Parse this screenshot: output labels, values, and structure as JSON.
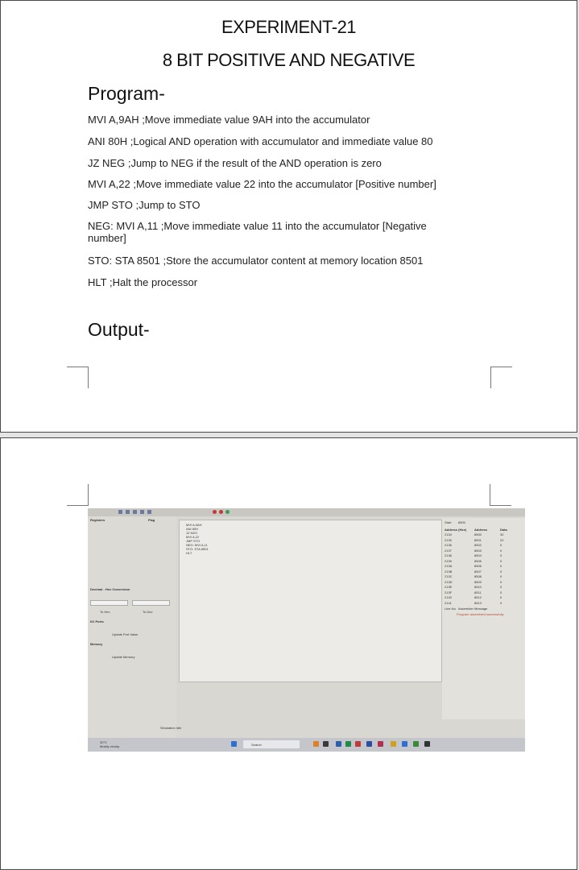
{
  "page1": {
    "title": "EXPERIMENT-21",
    "subtitle": "8 BIT POSITIVE AND NEGATIVE",
    "program_heading": "Program-",
    "program_lines": [
      "MVI A,9AH ;Move immediate value 9AH into the accumulator",
      "ANI 80H ;Logical AND operation with accumulator and immediate value 80",
      "JZ NEG ;Jump to NEG if the result of the AND operation is zero",
      "MVI A,22 ;Move immediate value 22 into the accumulator [Positive number]",
      "JMP STO ;Jump to STO",
      "NEG: MVI A,11 ;Move immediate value 11 into the accumulator [Negative number]",
      "STO: STA 8501 ;Store the accumulator content at memory location 8501",
      "HLT ;Halt the processor"
    ],
    "output_heading": "Output-"
  },
  "photo": {
    "registers_label": "Registers",
    "flag_label": "Flag",
    "dec_hex_label": "Decimal - Hex Conversion",
    "io_ports_label": "I/O Ports",
    "memory_label": "Memory",
    "update_port_label": "Update Port Value",
    "update_memory_label": "Update Memory",
    "to_hex_label": "To Hex",
    "to_dec_label": "To Dec",
    "simulation_label": "Simulation Idle",
    "search_placeholder": "Search",
    "start_label": "Start",
    "start_value": "8500",
    "table_headers": [
      "Address (Hex)",
      "Address",
      "Data"
    ],
    "table_rows": [
      [
        "2134",
        "8500",
        "32"
      ],
      [
        "2135",
        "8501",
        "22"
      ],
      [
        "2136",
        "8502",
        "0"
      ],
      [
        "2137",
        "8503",
        "0"
      ],
      [
        "2138",
        "8504",
        "0"
      ],
      [
        "2139",
        "8505",
        "0"
      ],
      [
        "213A",
        "8506",
        "0"
      ],
      [
        "213B",
        "8507",
        "0"
      ],
      [
        "213C",
        "8508",
        "0"
      ],
      [
        "213D",
        "8509",
        "0"
      ],
      [
        "213E",
        "8510",
        "0"
      ],
      [
        "213F",
        "8511",
        "0"
      ],
      [
        "2140",
        "8512",
        "0"
      ],
      [
        "2141",
        "8513",
        "0"
      ]
    ],
    "line_no_label": "Line No",
    "assembler_msg_label": "Assembler Message",
    "assembler_msg": "Program assembled successfully",
    "code_lines": [
      "MVI A,9AH",
      "ANI 80H",
      "JZ NEG",
      "MVI A,22",
      "JMP STO",
      "NEG: MVI A,11",
      "STO: STA 8501",
      "HLT"
    ],
    "weather_temp": "30°C",
    "weather_desc": "Mostly cloudy"
  }
}
